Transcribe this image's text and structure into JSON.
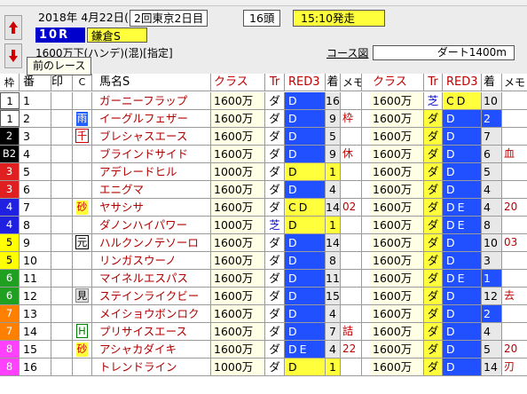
{
  "header": {
    "date": "2018年 4月22日(日)",
    "meet": "2回東京2日目",
    "heads": "16頭",
    "start_time": "15:10発走",
    "race_no": "10R",
    "race_name": "鎌倉S",
    "conditions": "1600万下(ハンデ)(混)[指定]",
    "course_link": "コース図",
    "distance": "ダート1400m",
    "tooltip": "前のレース"
  },
  "columns": [
    "枠",
    "番",
    "印",
    "C",
    "馬名S",
    "クラス",
    "Tr",
    "RED3",
    "着",
    "メモ",
    "クラス",
    "Tr",
    "RED3",
    "着",
    "メモ"
  ],
  "colors": {
    "waku": [
      "#ffffff",
      "#000000",
      "#e02020",
      "#2020e0",
      "#ffff00",
      "#20a020",
      "#ff8000",
      "#ff40ff"
    ],
    "race_red": "#c00000",
    "highlight": "#ffff3c",
    "blue_cell": "#2050ff"
  },
  "rows": [
    {
      "waku": "1",
      "num": "1",
      "mark": "",
      "sym": "",
      "name": "ガーニーフラップ",
      "cls1": "1600万",
      "tr1": "ダ",
      "red1": "D",
      "chk1": "16",
      "k1": "",
      "cls2": "1600万",
      "tr2": "芝",
      "red2": "CD",
      "chk2": "10",
      "k2": ""
    },
    {
      "waku": "1",
      "num": "2",
      "mark": "",
      "sym": "雨",
      "name": "イーグルフェザー",
      "cls1": "1600万",
      "tr1": "ダ",
      "red1": "D",
      "chk1": "9",
      "k1": "枠",
      "cls2": "1600万",
      "tr2": "ダ",
      "red2": "D",
      "chk2": "2",
      "k2": ""
    },
    {
      "waku": "2",
      "num": "3",
      "mark": "",
      "sym": "千",
      "name": "ブレシャスエース",
      "cls1": "1600万",
      "tr1": "ダ",
      "red1": "D",
      "chk1": "5",
      "k1": "",
      "cls2": "1600万",
      "tr2": "ダ",
      "red2": "D",
      "chk2": "7",
      "k2": ""
    },
    {
      "waku": "B2",
      "num": "4",
      "mark": "",
      "sym": "",
      "name": "ブラインドサイド",
      "cls1": "1600万",
      "tr1": "ダ",
      "red1": "D",
      "chk1": "9",
      "k1": "休",
      "cls2": "1600万",
      "tr2": "ダ",
      "red2": "D",
      "chk2": "6",
      "k2": "血"
    },
    {
      "waku": "3",
      "num": "5",
      "mark": "",
      "sym": "",
      "name": "アデレードヒル",
      "cls1": "1000万",
      "tr1": "ダ",
      "red1": "D",
      "chk1": "1",
      "k1": "",
      "cls2": "1600万",
      "tr2": "ダ",
      "red2": "D",
      "chk2": "5",
      "k2": ""
    },
    {
      "waku": "3",
      "num": "6",
      "mark": "",
      "sym": "",
      "name": "エニグマ",
      "cls1": "1600万",
      "tr1": "ダ",
      "red1": "D",
      "chk1": "4",
      "k1": "",
      "cls2": "1600万",
      "tr2": "ダ",
      "red2": "D",
      "chk2": "4",
      "k2": ""
    },
    {
      "waku": "4",
      "num": "7",
      "mark": "",
      "sym": "砂",
      "name": "ヤサシサ",
      "cls1": "1600万",
      "tr1": "ダ",
      "red1": "CD",
      "chk1": "14",
      "k1": "02",
      "cls2": "1600万",
      "tr2": "ダ",
      "red2": "DE",
      "chk2": "4",
      "k2": "20"
    },
    {
      "waku": "4",
      "num": "8",
      "mark": "",
      "sym": "",
      "name": "ダノンハイパワー",
      "cls1": "1000万",
      "tr1": "芝",
      "red1": "D",
      "chk1": "1",
      "k1": "",
      "cls2": "1600万",
      "tr2": "ダ",
      "red2": "DE",
      "chk2": "8",
      "k2": ""
    },
    {
      "waku": "5",
      "num": "9",
      "mark": "",
      "sym": "元",
      "name": "ハルクンノテソーロ",
      "cls1": "1600万",
      "tr1": "ダ",
      "red1": "D",
      "chk1": "14",
      "k1": "",
      "cls2": "1600万",
      "tr2": "ダ",
      "red2": "D",
      "chk2": "10",
      "k2": "03"
    },
    {
      "waku": "5",
      "num": "10",
      "mark": "",
      "sym": "",
      "name": "リンガスウーノ",
      "cls1": "1600万",
      "tr1": "ダ",
      "red1": "D",
      "chk1": "8",
      "k1": "",
      "cls2": "1600万",
      "tr2": "ダ",
      "red2": "D",
      "chk2": "3",
      "k2": ""
    },
    {
      "waku": "6",
      "num": "11",
      "mark": "",
      "sym": "",
      "name": "マイネルエスパス",
      "cls1": "1600万",
      "tr1": "ダ",
      "red1": "D",
      "chk1": "11",
      "k1": "",
      "cls2": "1600万",
      "tr2": "ダ",
      "red2": "DE",
      "chk2": "1",
      "k2": ""
    },
    {
      "waku": "6",
      "num": "12",
      "mark": "",
      "sym": "見",
      "name": "ステインライクビー",
      "cls1": "1600万",
      "tr1": "ダ",
      "red1": "D",
      "chk1": "15",
      "k1": "",
      "cls2": "1600万",
      "tr2": "ダ",
      "red2": "D",
      "chk2": "12",
      "k2": "去"
    },
    {
      "waku": "7",
      "num": "13",
      "mark": "",
      "sym": "",
      "name": "メイショウボンロク",
      "cls1": "1600万",
      "tr1": "ダ",
      "red1": "D",
      "chk1": "4",
      "k1": "",
      "cls2": "1600万",
      "tr2": "ダ",
      "red2": "D",
      "chk2": "2",
      "k2": ""
    },
    {
      "waku": "7",
      "num": "14",
      "mark": "",
      "sym": "H",
      "name": "プリサイスエース",
      "cls1": "1600万",
      "tr1": "ダ",
      "red1": "D",
      "chk1": "7",
      "k1": "詰",
      "cls2": "1600万",
      "tr2": "ダ",
      "red2": "D",
      "chk2": "4",
      "k2": ""
    },
    {
      "waku": "8",
      "num": "15",
      "mark": "",
      "sym": "砂",
      "name": "アシャカダイキ",
      "cls1": "1600万",
      "tr1": "ダ",
      "red1": "DE",
      "chk1": "4",
      "k1": "22",
      "cls2": "1600万",
      "tr2": "ダ",
      "red2": "D",
      "chk2": "5",
      "k2": "20"
    },
    {
      "waku": "8",
      "num": "16",
      "mark": "",
      "sym": "",
      "name": "トレンドライン",
      "cls1": "1000万",
      "tr1": "ダ",
      "red1": "D",
      "chk1": "1",
      "k1": "",
      "cls2": "1600万",
      "tr2": "ダ",
      "red2": "D",
      "chk2": "14",
      "k2": "刃"
    }
  ]
}
